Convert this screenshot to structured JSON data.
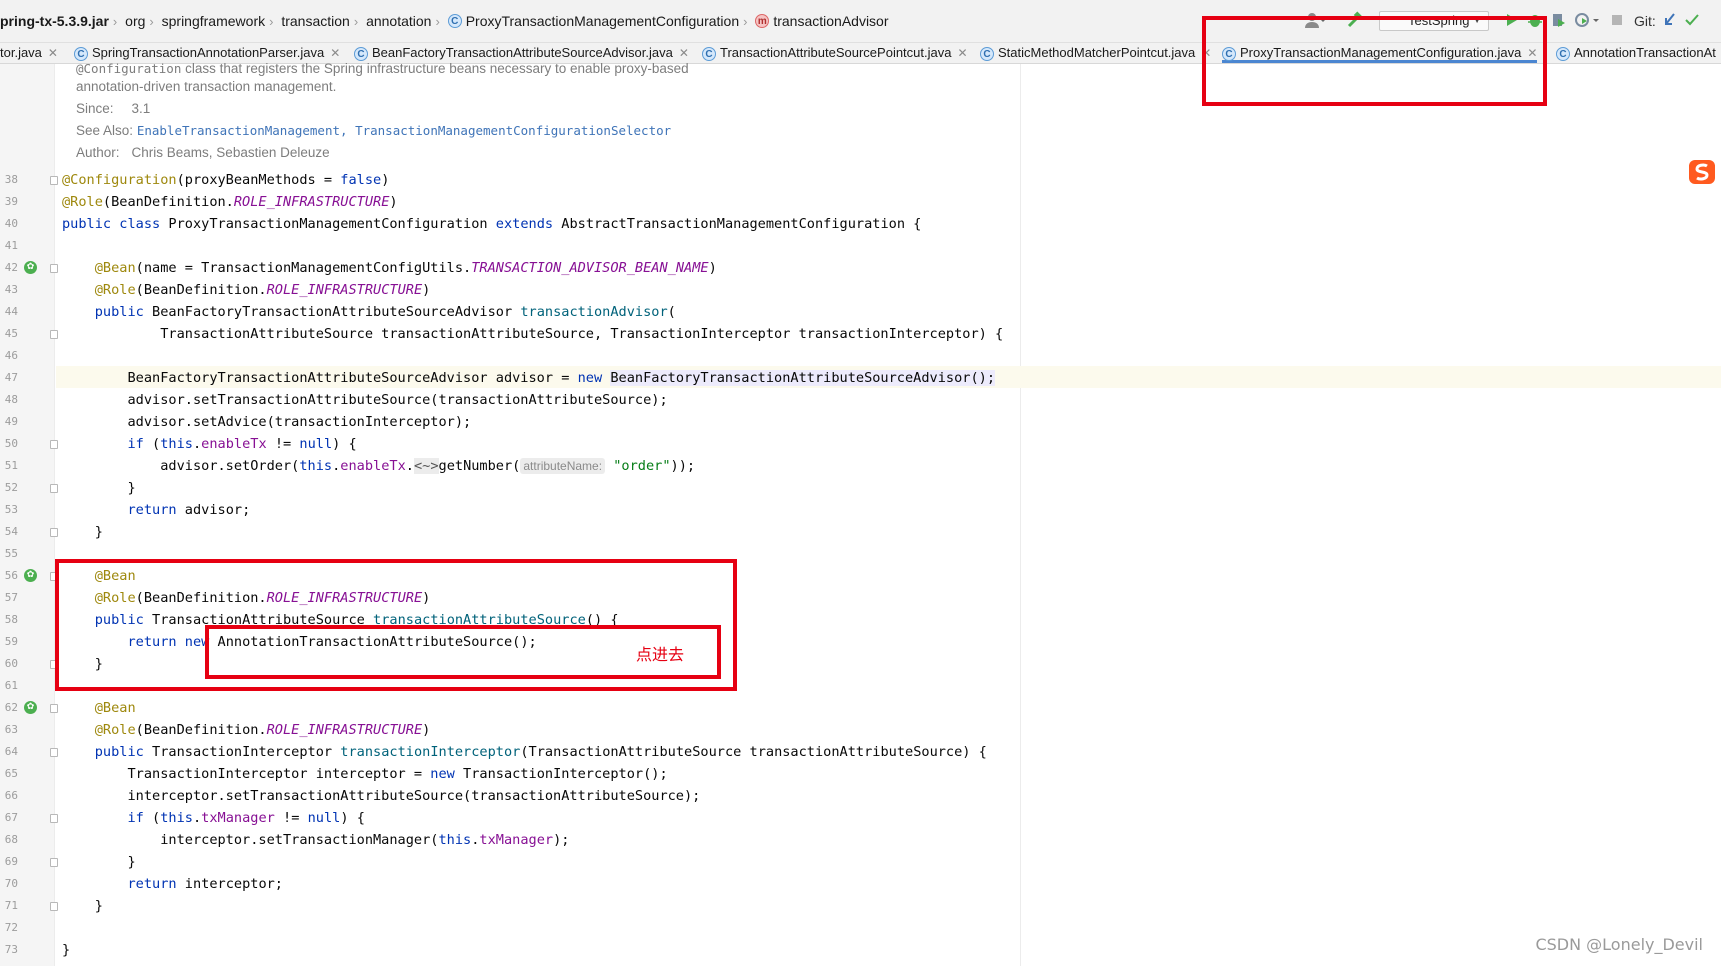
{
  "breadcrumb": {
    "items": [
      {
        "label": "pring-tx-5.3.9.jar",
        "bold": true
      },
      {
        "label": "org"
      },
      {
        "label": "springframework"
      },
      {
        "label": "transaction"
      },
      {
        "label": "annotation"
      },
      {
        "label": "ProxyTransactionManagementConfiguration",
        "icon": "C"
      },
      {
        "label": "transactionAdvisor",
        "icon": "m"
      }
    ]
  },
  "toolbar": {
    "run_config": "TestSpring",
    "git_label": "Git:"
  },
  "tabs": [
    {
      "label": "tor.java"
    },
    {
      "label": "SpringTransactionAnnotationParser.java"
    },
    {
      "label": "BeanFactoryTransactionAttributeSourceAdvisor.java"
    },
    {
      "label": "TransactionAttributeSourcePointcut.java"
    },
    {
      "label": "StaticMethodMatcherPointcut.java"
    },
    {
      "label": "ProxyTransactionManagementConfiguration.java",
      "active": true
    },
    {
      "label": "AnnotationTransactionAt"
    }
  ],
  "doc": {
    "line1_code": "@Configuration",
    "line1_text": " class that registers the Spring infrastructure beans necessary to enable proxy-based",
    "line2": "annotation-driven transaction management.",
    "since_label": "Since:",
    "since_value": "3.1",
    "see_label": "See Also:",
    "see_link1": "EnableTransactionManagement",
    "see_link2": "TransactionManagementConfigurationSelector",
    "author_label": "Author:",
    "author_value": "Chris Beams, Sebastien Deleuze"
  },
  "line_numbers": [
    "38",
    "39",
    "40",
    "41",
    "42",
    "43",
    "44",
    "45",
    "46",
    "47",
    "48",
    "49",
    "50",
    "51",
    "52",
    "53",
    "54",
    "55",
    "56",
    "57",
    "58",
    "59",
    "60",
    "61",
    "62",
    "63",
    "64",
    "65",
    "66",
    "67",
    "68",
    "69",
    "70",
    "71",
    "72",
    "73"
  ],
  "code": {
    "l38": [
      "@Configuration",
      "(proxyBeanMethods = ",
      "false",
      ")"
    ],
    "l39": [
      "@Role",
      "(BeanDefinition.",
      "ROLE_INFRASTRUCTURE",
      ")"
    ],
    "l40": [
      "public class ",
      "ProxyTransactionManagementConfiguration ",
      "extends ",
      "AbstractTransactionManagementConfiguration {"
    ],
    "l42": [
      "    ",
      "@Bean",
      "(name = TransactionManagementConfigUtils.",
      "TRANSACTION_ADVISOR_BEAN_NAME",
      ")"
    ],
    "l43": [
      "    ",
      "@Role",
      "(BeanDefinition.",
      "ROLE_INFRASTRUCTURE",
      ")"
    ],
    "l44": [
      "    ",
      "public ",
      "BeanFactoryTransactionAttributeSourceAdvisor ",
      "transactionAdvisor",
      "("
    ],
    "l45": "            TransactionAttributeSource transactionAttributeSource, TransactionInterceptor transactionInterceptor) {",
    "l47": [
      "        BeanFactoryTransactionAttributeSourceAdvisor advisor = ",
      "new ",
      "BeanFactoryTransactionAttributeSourceAdvisor();"
    ],
    "l48": "        advisor.setTransactionAttributeSource(transactionAttributeSource);",
    "l49": "        advisor.setAdvice(transactionInterceptor);",
    "l50": [
      "        ",
      "if ",
      "(",
      "this",
      ".",
      "enableTx",
      " != ",
      "null",
      ") {"
    ],
    "l51": [
      "            advisor.setOrder(",
      "this",
      ".",
      "enableTx",
      ".",
      "<~>",
      "getNumber(",
      "attributeName:",
      "\"order\"",
      "));"
    ],
    "l52": "        }",
    "l53": [
      "        ",
      "return ",
      "advisor;"
    ],
    "l54": "    }",
    "l56": [
      "    ",
      "@Bean"
    ],
    "l57": [
      "    ",
      "@Role",
      "(BeanDefinition.",
      "ROLE_INFRASTRUCTURE",
      ")"
    ],
    "l58": [
      "    ",
      "public ",
      "TransactionAttributeSource ",
      "transactionAttributeSource",
      "() {"
    ],
    "l59": [
      "        ",
      "return ",
      "new ",
      "AnnotationTransactionAttributeSource();"
    ],
    "l60": "    }",
    "l62": [
      "    ",
      "@Bean"
    ],
    "l63": [
      "    ",
      "@Role",
      "(BeanDefinition.",
      "ROLE_INFRASTRUCTURE",
      ")"
    ],
    "l64": [
      "    ",
      "public ",
      "TransactionInterceptor ",
      "transactionInterceptor",
      "(TransactionAttributeSource transactionAttributeSource) {"
    ],
    "l65": [
      "        TransactionInterceptor interceptor = ",
      "new ",
      "TransactionInterceptor();"
    ],
    "l66": "        interceptor.setTransactionAttributeSource(transactionAttributeSource);",
    "l67": [
      "        ",
      "if ",
      "(",
      "this",
      ".",
      "txManager",
      " != ",
      "null",
      ") {"
    ],
    "l68": [
      "            interceptor.setTransactionManager(",
      "this",
      ".",
      "txManager",
      ");"
    ],
    "l69": "        }",
    "l70": [
      "        ",
      "return ",
      "interceptor;"
    ],
    "l71": "    }",
    "l73": "}"
  },
  "annotation_note": "点进去",
  "watermark": "CSDN @Lonely_Devil",
  "colors": {
    "highlight_red": "#e60012",
    "keyword": "#0033b3",
    "annotation": "#9e880d",
    "static_field": "#871094",
    "method_decl": "#00627a",
    "string": "#067d17"
  }
}
